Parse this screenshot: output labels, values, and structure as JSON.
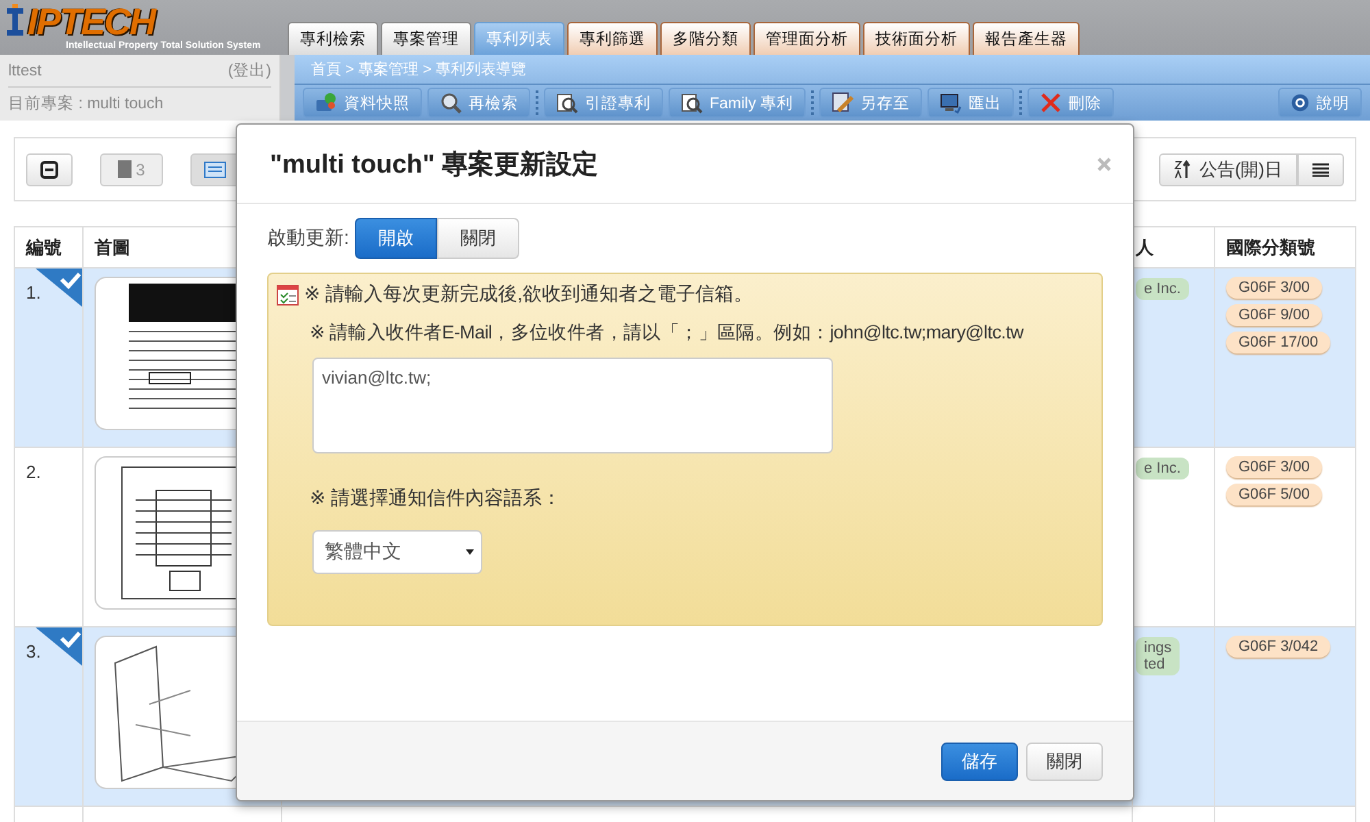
{
  "logo": {
    "name": "IPTECH",
    "subtitle": "Intellectual Property Total Solution System"
  },
  "main_tabs": [
    {
      "label": "專利檢索",
      "kind": "plain",
      "selected": false
    },
    {
      "label": "專案管理",
      "kind": "plain",
      "selected": false
    },
    {
      "label": "專利列表",
      "kind": "plain",
      "selected": true
    },
    {
      "label": "專利篩選",
      "kind": "analysis",
      "selected": false
    },
    {
      "label": "多階分類",
      "kind": "analysis",
      "selected": false
    },
    {
      "label": "管理面分析",
      "kind": "analysis",
      "selected": false
    },
    {
      "label": "技術面分析",
      "kind": "analysis",
      "selected": false
    },
    {
      "label": "報告產生器",
      "kind": "analysis",
      "selected": false
    }
  ],
  "user_panel": {
    "user": "lttest",
    "logout": "(登出)",
    "project": "目前專案 : multi touch"
  },
  "breadcrumb": "首頁 > 專案管理 > 專利列表導覽",
  "toolbar": [
    {
      "label": "資料快照",
      "kind": "snapshot",
      "separator_before": false
    },
    {
      "label": "再檢索",
      "kind": "search",
      "separator_before": false
    },
    {
      "label": "引證專利",
      "kind": "citation",
      "separator_before": true
    },
    {
      "label": "Family 專利",
      "kind": "citation",
      "separator_before": false
    },
    {
      "label": "另存至",
      "kind": "saveas",
      "separator_before": true
    },
    {
      "label": "匯出",
      "kind": "export",
      "separator_before": false
    },
    {
      "label": "刪除",
      "kind": "delete",
      "separator_before": true
    }
  ],
  "help_button": "說明",
  "list_toolbar": {
    "count": "3",
    "sort_button": "公告(開)日"
  },
  "table": {
    "columns": [
      "編號",
      "首圖",
      "人",
      "國際分類號"
    ],
    "rows": [
      {
        "number": "1.",
        "selected": true,
        "applicant": [
          "e Inc."
        ],
        "ipc": [
          "G06F 3/00",
          "G06F 9/00",
          "G06F 17/00"
        ]
      },
      {
        "number": "2.",
        "selected": false,
        "applicant": [
          "e Inc."
        ],
        "ipc": [
          "G06F 3/00",
          "G06F 5/00"
        ]
      },
      {
        "number": "3.",
        "selected": true,
        "applicant": [
          "ings",
          "ted"
        ],
        "ipc": [
          "G06F 3/042"
        ]
      }
    ]
  },
  "dialog": {
    "title": "\"multi touch\" 專案更新設定",
    "toggle_label": "啟動更新:",
    "toggle": [
      {
        "label": "開啟",
        "selected": true
      },
      {
        "label": "關閉",
        "selected": false
      }
    ],
    "instruction": "※ 請輸入每次更新完成後,欲收到通知者之電子信箱。",
    "email_hint": "※ 請輸入收件者E-Mail，多位收件者，請以「；」區隔。例如：john@ltc.tw;mary@ltc.tw",
    "email_value": "vivian@ltc.tw;",
    "language_label": "※ 請選擇通知信件內容語系：",
    "language": "繁體中文",
    "save": "儲存",
    "close": "關閉"
  }
}
